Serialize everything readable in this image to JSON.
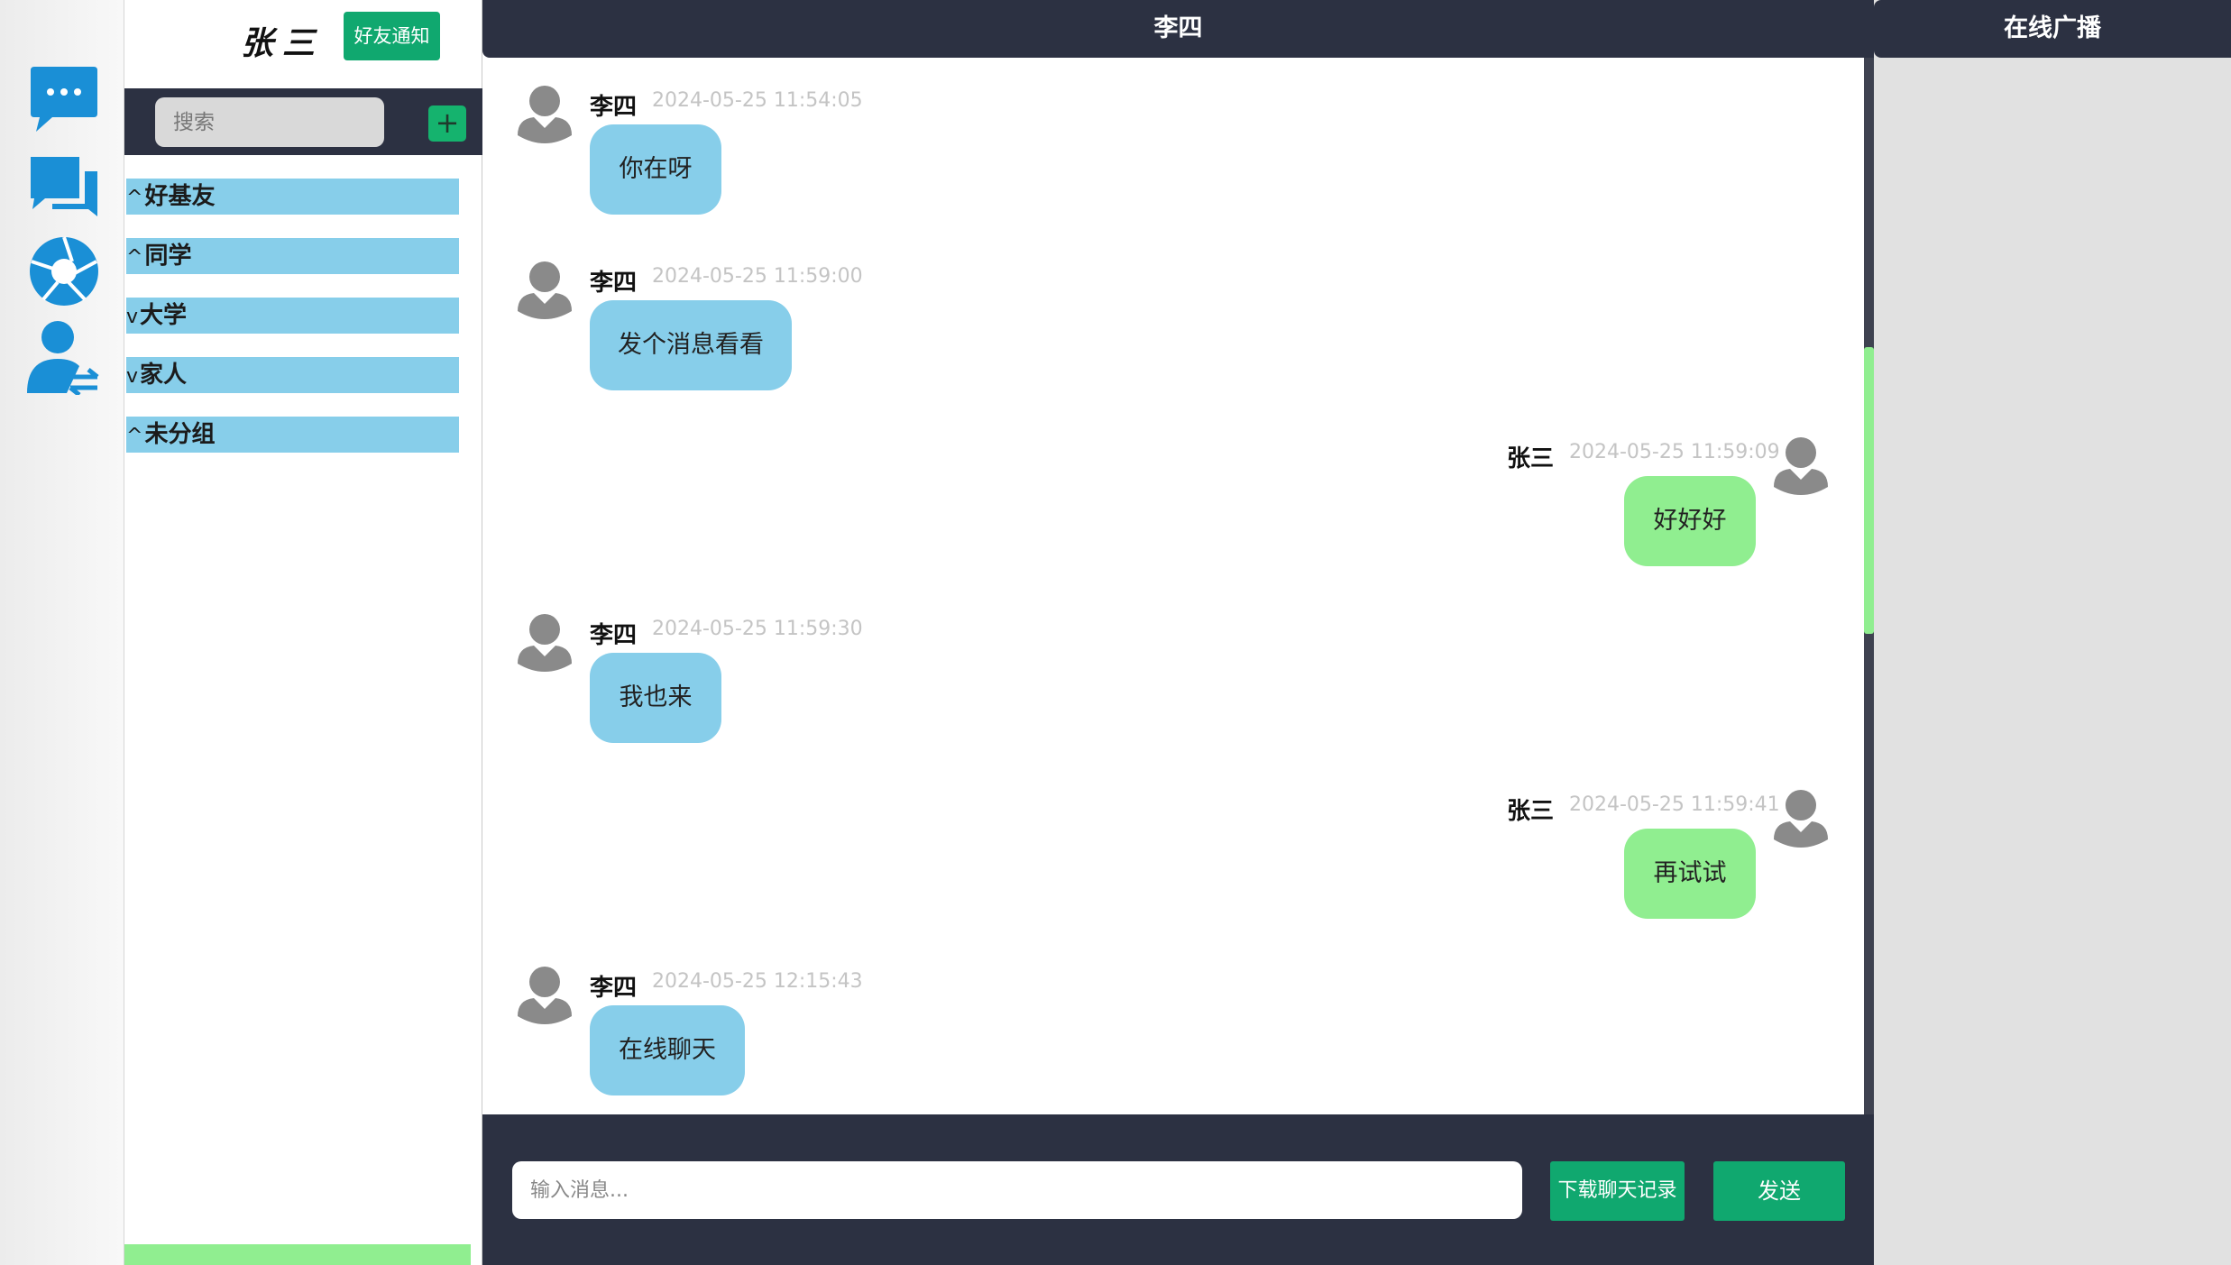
{
  "rail": {
    "icons": [
      {
        "name": "chat-bubble-icon",
        "color": "#1a8fd6"
      },
      {
        "name": "conversations-icon",
        "color": "#1a8fd6"
      },
      {
        "name": "aperture-icon",
        "color": "#1a8fd6"
      },
      {
        "name": "user-switch-icon",
        "color": "#1a8fd6"
      }
    ]
  },
  "friends": {
    "user_name": "张三",
    "notify_label": "好友通知",
    "search_placeholder": "搜索",
    "add_label": "+",
    "groups": [
      {
        "arrow": "^",
        "label": "好基友"
      },
      {
        "arrow": "^",
        "label": "同学"
      },
      {
        "arrow": "v",
        "label": "大学"
      },
      {
        "arrow": "v",
        "label": "家人"
      },
      {
        "arrow": "^",
        "label": "未分组"
      }
    ]
  },
  "chat": {
    "title": "李四",
    "messages": [
      {
        "sender": "李四",
        "time": "2024-05-25 11:54:05",
        "text": "你在呀",
        "direction": "in"
      },
      {
        "sender": "李四",
        "time": "2024-05-25 11:59:00",
        "text": "发个消息看看",
        "direction": "in"
      },
      {
        "sender": "张三",
        "time": "2024-05-25 11:59:09",
        "text": "好好好",
        "direction": "out"
      },
      {
        "sender": "李四",
        "time": "2024-05-25 11:59:30",
        "text": "我也来",
        "direction": "in"
      },
      {
        "sender": "张三",
        "time": "2024-05-25 11:59:41",
        "text": "再试试",
        "direction": "out"
      },
      {
        "sender": "李四",
        "time": "2024-05-25 12:15:43",
        "text": "在线聊天",
        "direction": "in"
      }
    ],
    "input_placeholder": "输入消息...",
    "download_label": "下载聊天记录",
    "send_label": "发送"
  },
  "broadcast": {
    "title": "在线广播"
  },
  "colors": {
    "dark_bar": "#2c3142",
    "accent_green": "#10a86f",
    "incoming_bubble": "#87ceea",
    "outgoing_bubble": "#90ee90",
    "group_bar": "#87ceea"
  }
}
